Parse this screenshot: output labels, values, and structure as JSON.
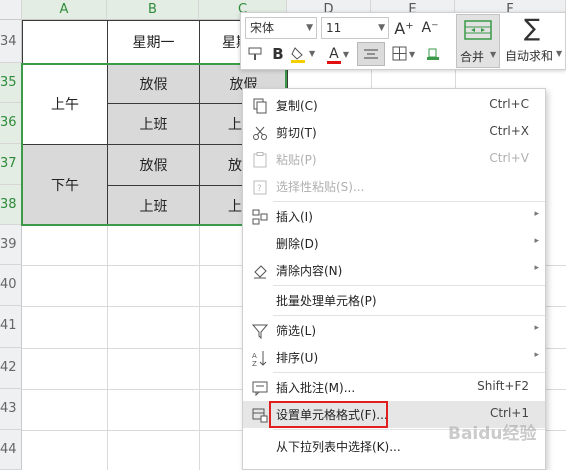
{
  "sheet": {
    "columns": [
      "A",
      "B",
      "C",
      "D",
      "E",
      "F"
    ],
    "rows": [
      "34",
      "35",
      "36",
      "37",
      "38",
      "39",
      "40",
      "41",
      "42",
      "43",
      "44"
    ],
    "cells": {
      "b34": "星期一",
      "c34": "星期",
      "a35": "上午",
      "b35": "放假",
      "c35": "放假",
      "b36": "上班",
      "c36": "上",
      "a37": "下午",
      "b37": "放假",
      "c37": "放",
      "b38": "上班",
      "c38": "上"
    },
    "selection_color": "#3c9a48"
  },
  "toolbar": {
    "font_name": "宋体",
    "font_size": "11",
    "grow_font": "A⁺",
    "shrink_font": "A⁻",
    "merge_label": "合并",
    "autosum_label": "自动求和",
    "sigma": "∑",
    "bold": "B",
    "font_color_letter": "A"
  },
  "menu": {
    "items": [
      {
        "label": "复制(C)",
        "shortcut": "Ctrl+C",
        "icon": "copy-icon"
      },
      {
        "label": "剪切(T)",
        "shortcut": "Ctrl+X",
        "icon": "scissors-icon"
      },
      {
        "label": "粘贴(P)",
        "shortcut": "Ctrl+V",
        "icon": "paste-icon",
        "disabled": true
      },
      {
        "label": "选择性粘贴(S)...",
        "shortcut": "",
        "icon": "paste-special-icon",
        "disabled": true
      },
      {
        "label": "插入(I)",
        "shortcut": "",
        "icon": "insert-icon",
        "submenu": true
      },
      {
        "label": "删除(D)",
        "shortcut": "",
        "icon": "",
        "submenu": true
      },
      {
        "label": "清除内容(N)",
        "shortcut": "",
        "icon": "eraser-icon",
        "submenu": true
      },
      {
        "label": "批量处理单元格(P)",
        "shortcut": "",
        "icon": ""
      },
      {
        "label": "筛选(L)",
        "shortcut": "",
        "icon": "filter-icon",
        "submenu": true
      },
      {
        "label": "排序(U)",
        "shortcut": "",
        "icon": "sort-icon",
        "submenu": true
      },
      {
        "label": "插入批注(M)...",
        "shortcut": "Shift+F2",
        "icon": "comment-icon"
      },
      {
        "label": "设置单元格格式(F)...",
        "shortcut": "Ctrl+1",
        "icon": "format-cells-icon"
      },
      {
        "label": "从下拉列表中选择(K)...",
        "shortcut": "",
        "icon": ""
      }
    ]
  },
  "watermark": "Baidu经验"
}
